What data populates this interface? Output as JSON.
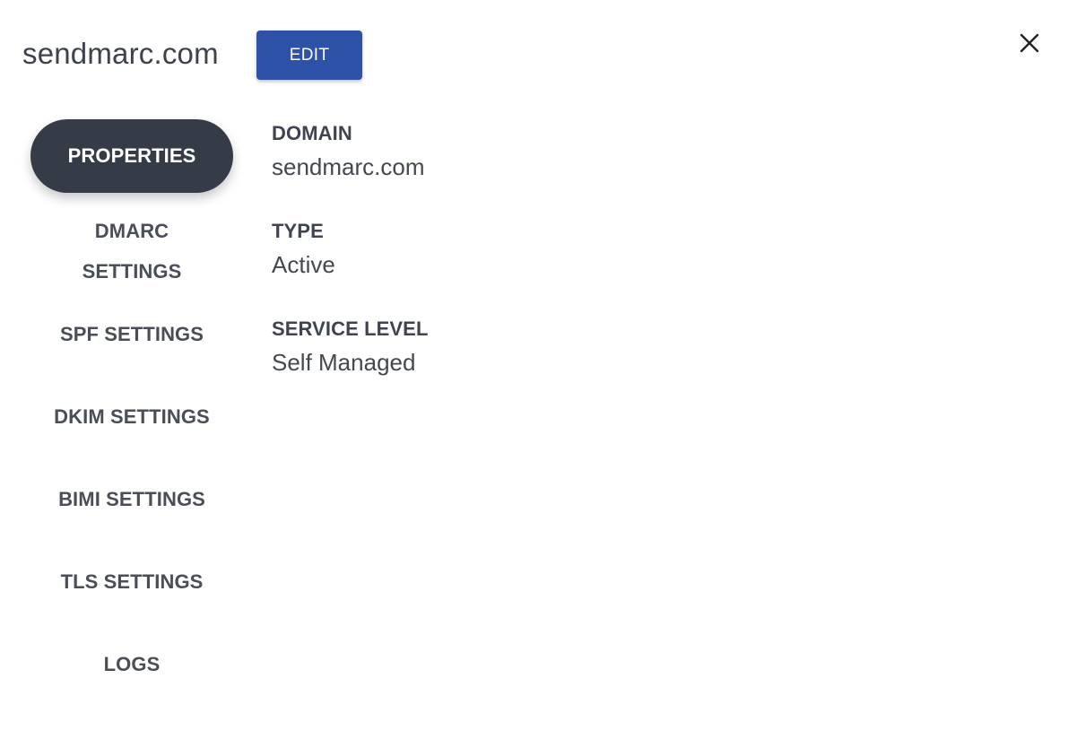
{
  "header": {
    "domain_title": "sendmarc.com",
    "edit_label": "EDIT",
    "close_icon": "close-icon"
  },
  "sidebar": {
    "items": [
      {
        "label": "PROPERTIES",
        "active": true
      },
      {
        "label": "DMARC SETTINGS",
        "active": false
      },
      {
        "label": "SPF SETTINGS",
        "active": false
      },
      {
        "label": "DKIM SETTINGS",
        "active": false
      },
      {
        "label": "BIMI SETTINGS",
        "active": false
      },
      {
        "label": "TLS SETTINGS",
        "active": false
      },
      {
        "label": "LOGS",
        "active": false
      }
    ]
  },
  "details": {
    "domain_label": "DOMAIN",
    "domain_value": "sendmarc.com",
    "type_label": "TYPE",
    "type_value": "Active",
    "service_level_label": "SERVICE LEVEL",
    "service_level_value": "Self Managed"
  },
  "colors": {
    "primary_button": "#2d52a8",
    "active_nav": "#363c47"
  }
}
